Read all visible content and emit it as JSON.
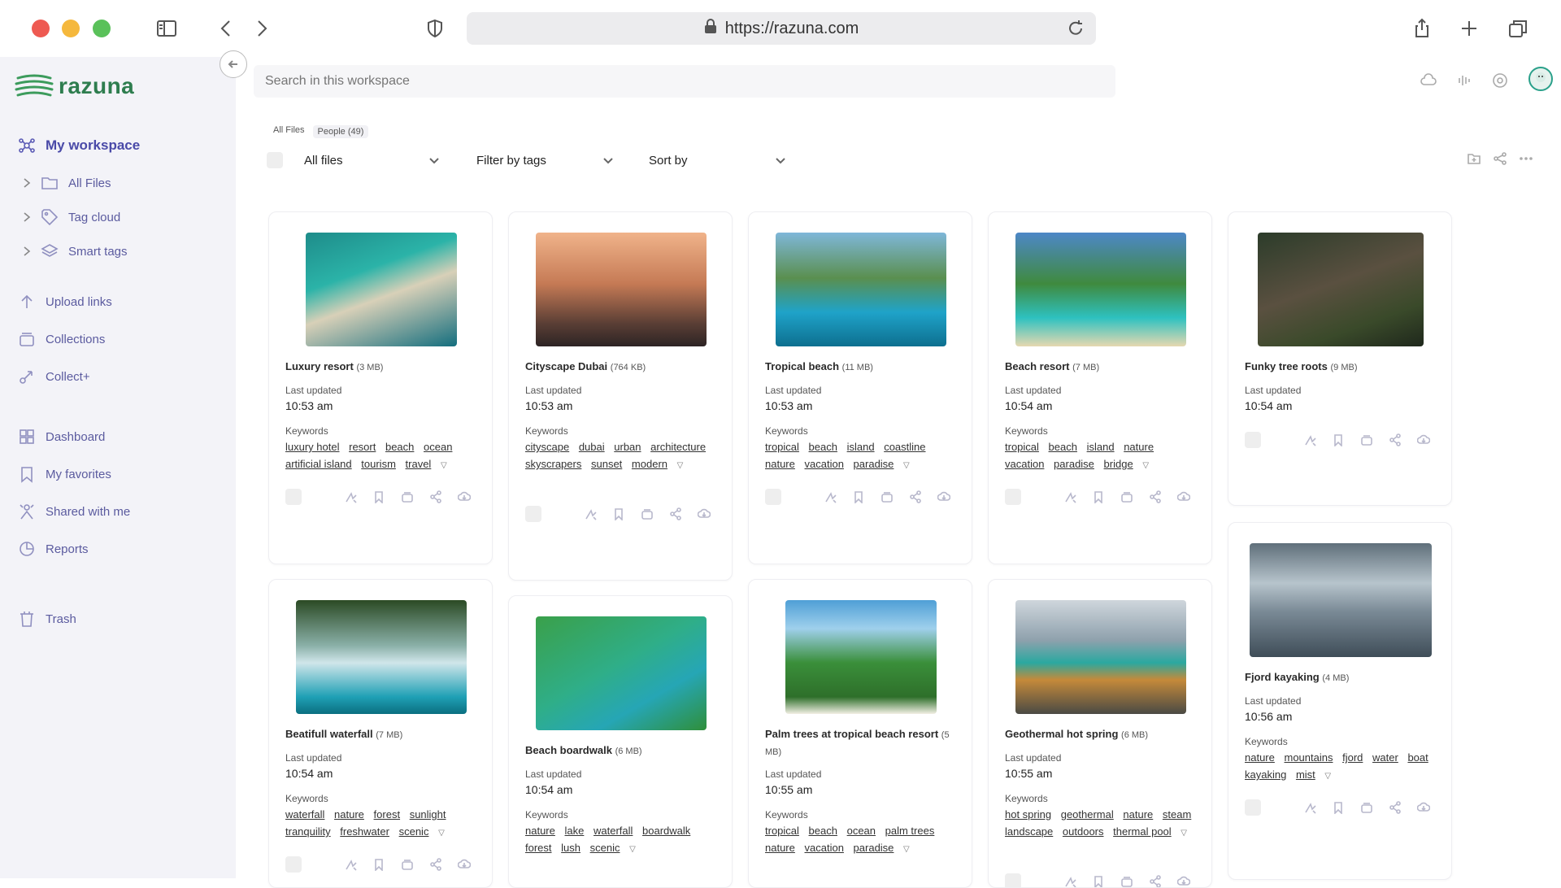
{
  "browser": {
    "url": "https://razuna.com"
  },
  "sidebar": {
    "brand": "razuna",
    "workspace": "My workspace",
    "tree": [
      {
        "label": "All Files"
      },
      {
        "label": "Tag cloud"
      },
      {
        "label": "Smart tags"
      }
    ],
    "items": [
      {
        "label": "Upload links"
      },
      {
        "label": "Collections"
      },
      {
        "label": "Collect+"
      },
      {
        "label": "Dashboard"
      },
      {
        "label": "My favorites"
      },
      {
        "label": "Shared with me"
      },
      {
        "label": "Reports"
      },
      {
        "label": "Trash"
      }
    ]
  },
  "search": {
    "placeholder": "Search in this workspace"
  },
  "crumbs": {
    "all": "All Files",
    "people": "People (49)"
  },
  "filters": {
    "all_files": "All files",
    "tags": "Filter by tags",
    "sort": "Sort by"
  },
  "labels": {
    "updated": "Last updated",
    "keywords": "Keywords"
  },
  "cards": [
    {
      "title": "Luxury resort",
      "size": "(3 MB)",
      "time": "10:53 am",
      "keywords": [
        "luxury hotel",
        "resort",
        "beach",
        "ocean",
        "artificial island",
        "tourism",
        "travel"
      ]
    },
    {
      "title": "Cityscape Dubai",
      "size": "(764 KB)",
      "time": "10:53 am",
      "keywords": [
        "cityscape",
        "dubai",
        "urban",
        "architecture",
        "skyscrapers",
        "sunset",
        "modern"
      ]
    },
    {
      "title": "Tropical beach",
      "size": "(11 MB)",
      "time": "10:53 am",
      "keywords": [
        "tropical",
        "beach",
        "island",
        "coastline",
        "nature",
        "vacation",
        "paradise"
      ]
    },
    {
      "title": "Beach resort",
      "size": "(7 MB)",
      "time": "10:54 am",
      "keywords": [
        "tropical",
        "beach",
        "island",
        "nature",
        "vacation",
        "paradise",
        "bridge"
      ]
    },
    {
      "title": "Funky tree roots",
      "size": "(9 MB)",
      "time": "10:54 am",
      "keywords": []
    },
    {
      "title": "Beatifull waterfall",
      "size": "(7 MB)",
      "time": "10:54 am",
      "keywords": [
        "waterfall",
        "nature",
        "forest",
        "sunlight",
        "tranquility",
        "freshwater",
        "scenic"
      ]
    },
    {
      "title": "Beach boardwalk",
      "size": "(6 MB)",
      "time": "10:54 am",
      "keywords": [
        "nature",
        "lake",
        "waterfall",
        "boardwalk",
        "forest",
        "lush",
        "scenic"
      ]
    },
    {
      "title": "Palm trees at tropical beach resort",
      "size": "(5 MB)",
      "time": "10:55 am",
      "keywords": [
        "tropical",
        "beach",
        "ocean",
        "palm trees",
        "nature",
        "vacation",
        "paradise"
      ]
    },
    {
      "title": "Geothermal hot spring",
      "size": "(6 MB)",
      "time": "10:55 am",
      "keywords": [
        "hot spring",
        "geothermal",
        "nature",
        "steam",
        "landscape",
        "outdoors",
        "thermal pool"
      ]
    },
    {
      "title": "Fjord kayaking",
      "size": "(4 MB)",
      "time": "10:56 am",
      "keywords": [
        "nature",
        "mountains",
        "fjord",
        "water",
        "boat",
        "kayaking",
        "mist"
      ]
    }
  ]
}
